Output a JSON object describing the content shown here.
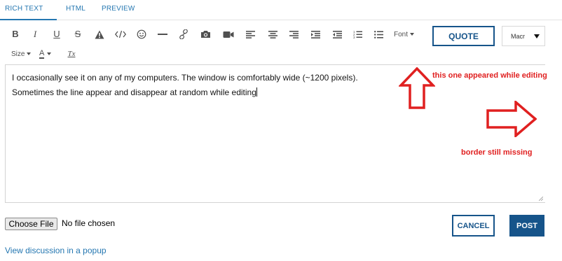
{
  "tabs": [
    {
      "label": "RICH TEXT",
      "active": true
    },
    {
      "label": "HTML",
      "active": false
    },
    {
      "label": "PREVIEW",
      "active": false
    }
  ],
  "toolbar": {
    "bold_label": "B",
    "italic_label": "I",
    "underline_label": "U",
    "strike_label": "S",
    "font_label": "Font",
    "size_label": "Size",
    "text_color_label": "A",
    "clear_format_label": "Tx",
    "quote_label": "QUOTE",
    "macro_label": "Macr",
    "icons": [
      "bold-icon",
      "italic-icon",
      "underline-icon",
      "strikethrough-icon",
      "spoiler-warning-icon",
      "code-icon",
      "smiley-icon",
      "horizontal-rule-icon",
      "link-icon",
      "camera-icon",
      "video-icon",
      "align-left-icon",
      "align-center-icon",
      "align-right-icon",
      "indent-icon",
      "outdent-icon",
      "numbered-list-icon",
      "bullet-list-icon",
      "text-color-icon",
      "clear-format-icon"
    ]
  },
  "editor": {
    "lines": [
      "I occasionally see it on any of my computers. The window is comfortably wide (~1200 pixels).",
      "Sometimes the line appear and disappear at random while editing"
    ]
  },
  "file": {
    "button_label": "Choose File",
    "status": "No file chosen"
  },
  "actions": {
    "cancel_label": "CANCEL",
    "post_label": "POST"
  },
  "popup_link": "View discussion in a popup",
  "annotations": {
    "top": "this one appeared while editing",
    "right": "border still missing"
  },
  "colors": {
    "accent": "#2577b1",
    "primary_button": "#16548a",
    "annotation": "#e02020",
    "icon": "#505050"
  }
}
